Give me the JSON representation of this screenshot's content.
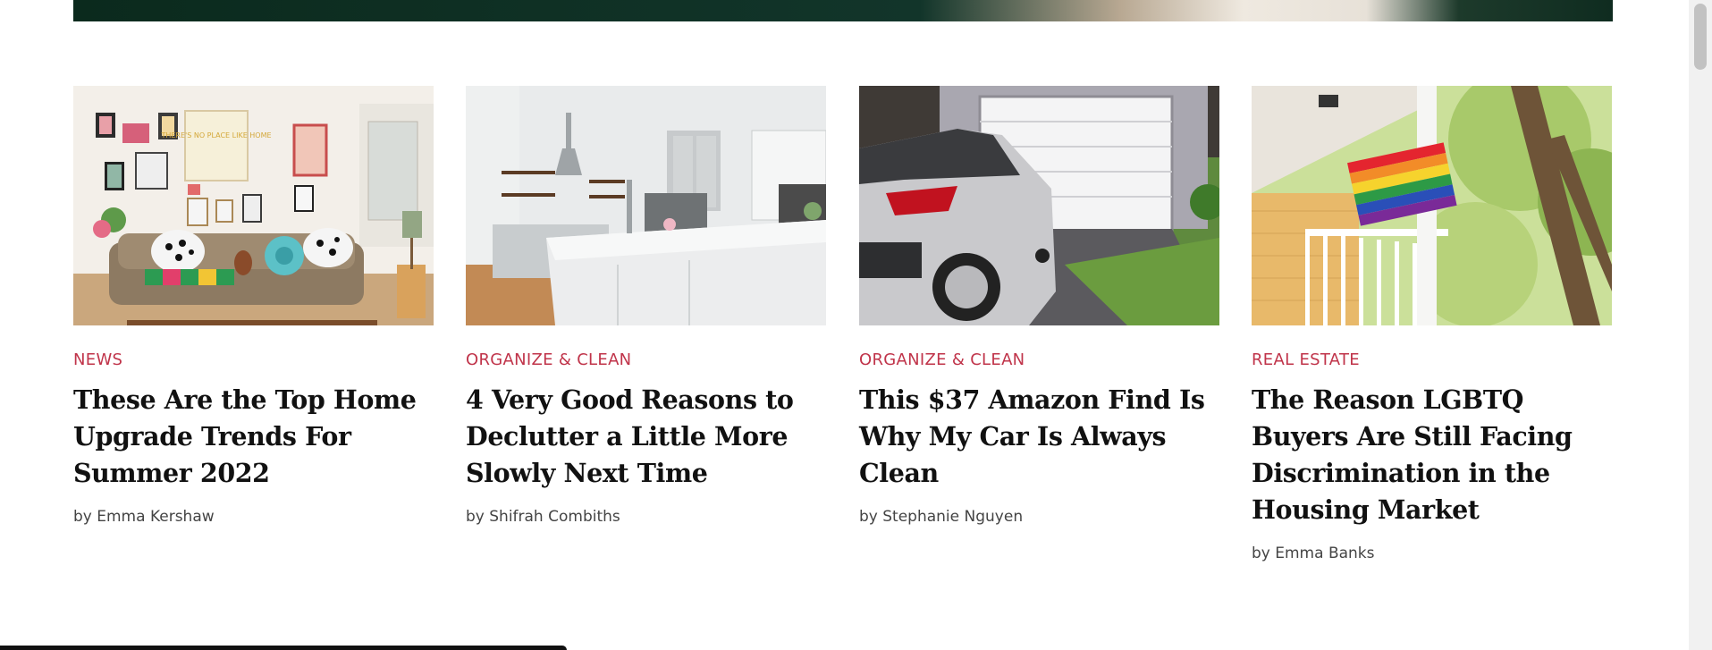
{
  "articles": [
    {
      "category": "News",
      "title": "These Are the Top Home Upgrade Trends For Summer 2022",
      "author": "by Emma Kershaw",
      "image": "living-room-gallery-wall"
    },
    {
      "category": "Organize & Clean",
      "title": "4 Very Good Reasons to Declutter a Little More Slowly Next Time",
      "author": "by Shifrah Combiths",
      "image": "white-kitchen"
    },
    {
      "category": "Organize & Clean",
      "title": "This $37 Amazon Find Is Why My Car Is Always Clean",
      "author": "by Stephanie Nguyen",
      "image": "silver-car-garage"
    },
    {
      "category": "Real Estate",
      "title": "The Reason LGBTQ Buyers Are Still Facing Discrimination in the Housing Market",
      "author": "by Emma Banks",
      "image": "porch-rainbow-flag"
    }
  ],
  "colors": {
    "category": "#c0344a",
    "title": "#111111",
    "byline": "#444444"
  },
  "thumbnail_art": {
    "living_room_poster_text": "THERE'S NO PLACE LIKE HOME"
  }
}
